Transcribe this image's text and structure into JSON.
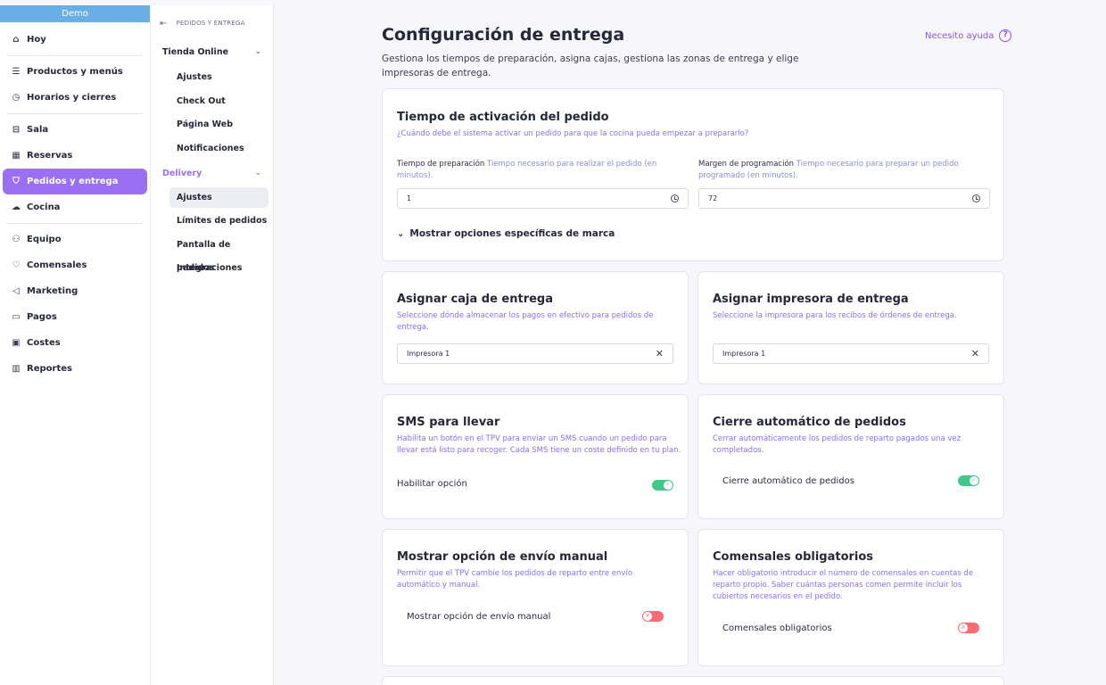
{
  "sidebar": {
    "workspace": "Demo",
    "items": [
      {
        "label": "Hoy",
        "icon": "home-icon"
      },
      {
        "label": "Productos y menús",
        "icon": "list-icon"
      },
      {
        "label": "Horarios y cierres",
        "icon": "clock-icon"
      },
      {
        "label": "Sala",
        "icon": "table-icon"
      },
      {
        "label": "Reservas",
        "icon": "calendar-icon"
      },
      {
        "label": "Pedidos y entrega",
        "icon": "basket-icon"
      },
      {
        "label": "Cocina",
        "icon": "chef-hat-icon"
      },
      {
        "label": "Equipo",
        "icon": "users-icon"
      },
      {
        "label": "Comensales",
        "icon": "heart-icon"
      },
      {
        "label": "Marketing",
        "icon": "megaphone-icon"
      },
      {
        "label": "Pagos",
        "icon": "card-icon"
      },
      {
        "label": "Costes",
        "icon": "wallet-icon"
      },
      {
        "label": "Reportes",
        "icon": "chart-icon"
      }
    ]
  },
  "subnav": {
    "header": "PEDIDOS Y ENTREGA",
    "group1": "Tienda Online",
    "group1_items": [
      "Ajustes",
      "Check Out",
      "Página Web",
      "Notificaciones"
    ],
    "group2": "Delivery",
    "group2_items": [
      "Ajustes",
      "Límites de pedidos",
      "Pantalla de pedidos",
      "Integraciones"
    ]
  },
  "page": {
    "title": "Configuración de entrega",
    "description": "Gestiona los tiempos de preparación, asigna cajas, gestiona las zonas de entrega y elige impresoras de entrega.",
    "help": "Necesito ayuda"
  },
  "activation": {
    "title": "Tiempo de activación del pedido",
    "subtitle": "¿Cuándo debe el sistema activar un pedido para que la cocina pueda empezar a prepararlo?",
    "prep_label": "Tiempo de preparación",
    "prep_hint": "Tiempo necesario para realizar el pedido (en minutos).",
    "prep_value": "1",
    "margin_label": "Margen de programación",
    "margin_hint": "Tiempo necesario para preparar un pedido programado (en minutos).",
    "margin_value": "72",
    "brand_toggle": "Mostrar opciones específicas de marca"
  },
  "cash": {
    "title": "Asignar caja de entrega",
    "subtitle": "Seleccione dónde almacenar los pagos en efectivo para pedidos de entrega.",
    "value": "Impresora 1"
  },
  "printer": {
    "title": "Asignar impresora de entrega",
    "subtitle": "Seleccione la impresora para los recibos de órdenes de entrega.",
    "value": "Impresora 1"
  },
  "sms": {
    "title": "SMS para llevar",
    "subtitle": "Habilita un botón en el TPV para enviar un SMS cuando un pedido para llevar está listo para recoger. Cada SMS tiene un coste definido en tu plan.",
    "row_label": "Habilitar opción",
    "state": "on"
  },
  "autoclose": {
    "title": "Cierre automático de pedidos",
    "subtitle": "Cerrar automáticamente los pedidos de reparto pagados una vez completados.",
    "row_label": "Cierre automático de pedidos",
    "state": "on"
  },
  "manual": {
    "title": "Mostrar opción de envío manual",
    "subtitle": "Permitir que el TPV cambie los pedidos de reparto entre envío automático y manual.",
    "row_label": "Mostrar opción de envío manual",
    "state": "off"
  },
  "diners": {
    "title": "Comensales obligatorios",
    "subtitle": "Hacer obligatorio introducir el número de comensales en cuentas de reparto propio. Saber cuántas personas comen permite incluir los cubiertos necesarios en el pedido.",
    "row_label": "Comensales obligatorios",
    "state": "off"
  },
  "colors": {
    "accent": "#9b6ff2",
    "toggle_on": "#3ec98a",
    "toggle_off": "#ff6b73",
    "demo_bar": "#6aaee6"
  }
}
